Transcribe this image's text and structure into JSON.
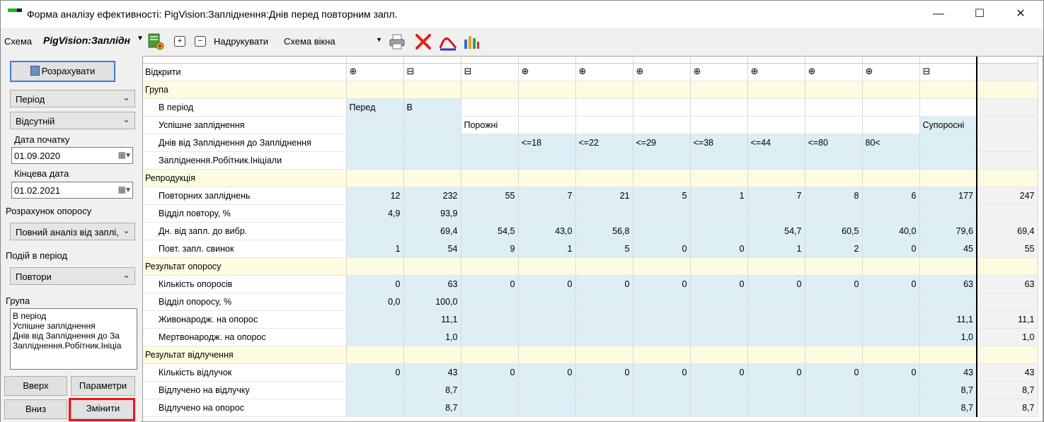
{
  "window": {
    "title": "Форма аналізу ефективності: PigVision:Запліднення:Днів перед повторним запл.",
    "controls": [
      "—",
      "☐",
      "✕"
    ]
  },
  "toolbar": {
    "scheme_label": "Схема",
    "scheme_value": "PigVision:Заплідн",
    "expand_label": "+",
    "collapse_label": "−",
    "print_label": "Надрукувати",
    "print_value": "Схема вікна",
    "icons": [
      "report-settings-icon",
      "printer-icon",
      "delete-icon",
      "chart-curve-icon",
      "bar-chart-icon"
    ]
  },
  "left": {
    "calculate_label": "Розрахувати",
    "period_value": "Період",
    "absent_value": "Відсутній",
    "start_date_label": "Дата початку",
    "start_date": "01.09.2020",
    "end_date_label": "Кінцева дата",
    "end_date": "01.02.2021",
    "farrowing_calc_label": "Розрахунок опоросу",
    "farrowing_calc_value": "Повний аналіз від заплі,",
    "events_label": "Подій в період",
    "events_value": "Повтори",
    "group_label": "Група",
    "group_items": [
      "В період",
      "Успішне запліднення",
      "Днів від Запліднення  до За",
      "Запліднення.Робітник.Ініціа"
    ],
    "up_label": "Вверх",
    "params_label": "Параметри",
    "down_label": "Вниз",
    "change_label": "Змінити"
  },
  "grid": {
    "open_label": "Відкрити",
    "expand_icons": [
      "⊕",
      "⊟",
      "⊟",
      "⊕",
      "⊕",
      "⊕",
      "⊕",
      "⊕",
      "⊕",
      "⊕",
      "⊟"
    ],
    "group_section": "Група",
    "period_row": {
      "label": "В період",
      "cells": [
        "Перед",
        "В",
        "",
        "",
        "",
        "",
        "",
        "",
        "",
        "",
        ""
      ]
    },
    "success_row": {
      "label": "Успішне запліднення",
      "cells": [
        "",
        "",
        "Порожні",
        "",
        "",
        "",
        "",
        "",
        "",
        "",
        "Супоросні"
      ]
    },
    "days_row": {
      "label": "Днів від Запліднення  до Запліднення",
      "cells": [
        "",
        "",
        "",
        "<=18",
        "<=22",
        "<=29",
        "<=38",
        "<=44",
        "<=80",
        "80<",
        ""
      ]
    },
    "worker_row": {
      "label": "Запліднення.Робітник.Ініціали"
    },
    "sections": [
      {
        "title": "Репродукція",
        "rows": [
          {
            "label": "Повторних запліднень",
            "cells": [
              "12",
              "232",
              "55",
              "7",
              "21",
              "5",
              "1",
              "7",
              "8",
              "6",
              "177"
            ],
            "total": "247"
          },
          {
            "label": "Відділ повтору, %",
            "cells": [
              "4,9",
              "93,9",
              "",
              "",
              "",
              "",
              "",
              "",
              "",
              "",
              ""
            ],
            "total": ""
          },
          {
            "label": "Дн. від запл. до вибр.",
            "cells": [
              "",
              "69,4",
              "54,5",
              "43,0",
              "56,8",
              "",
              "",
              "54,7",
              "60,5",
              "40,0",
              "79,6"
            ],
            "total": "69,4"
          },
          {
            "label": "Повт. запл. свинок",
            "cells": [
              "1",
              "54",
              "9",
              "1",
              "5",
              "0",
              "0",
              "1",
              "2",
              "0",
              "45"
            ],
            "total": "55"
          }
        ]
      },
      {
        "title": "Результат опоросу",
        "rows": [
          {
            "label": "Кількість опоросів",
            "cells": [
              "0",
              "63",
              "0",
              "0",
              "0",
              "0",
              "0",
              "0",
              "0",
              "0",
              "63"
            ],
            "total": "63"
          },
          {
            "label": "Відділ опоросу, %",
            "cells": [
              "0,0",
              "100,0",
              "",
              "",
              "",
              "",
              "",
              "",
              "",
              "",
              ""
            ],
            "total": ""
          },
          {
            "label": "Живонародж. на опорос",
            "cells": [
              "",
              "11,1",
              "",
              "",
              "",
              "",
              "",
              "",
              "",
              "",
              "11,1"
            ],
            "total": "11,1"
          },
          {
            "label": "Мертвонародж. на опорос",
            "cells": [
              "",
              "1,0",
              "",
              "",
              "",
              "",
              "",
              "",
              "",
              "",
              "1,0"
            ],
            "total": "1,0"
          }
        ]
      },
      {
        "title": "Результат відлучення",
        "rows": [
          {
            "label": "Кількість відлучок",
            "cells": [
              "0",
              "43",
              "0",
              "0",
              "0",
              "0",
              "0",
              "0",
              "0",
              "0",
              "43"
            ],
            "total": "43"
          },
          {
            "label": "Відлучено на відлучку",
            "cells": [
              "",
              "8,7",
              "",
              "",
              "",
              "",
              "",
              "",
              "",
              "",
              "8,7"
            ],
            "total": "8,7"
          },
          {
            "label": "Відлучено на опорос",
            "cells": [
              "",
              "8,7",
              "",
              "",
              "",
              "",
              "",
              "",
              "",
              "",
              "8,7"
            ],
            "total": "8,7"
          }
        ]
      }
    ]
  }
}
